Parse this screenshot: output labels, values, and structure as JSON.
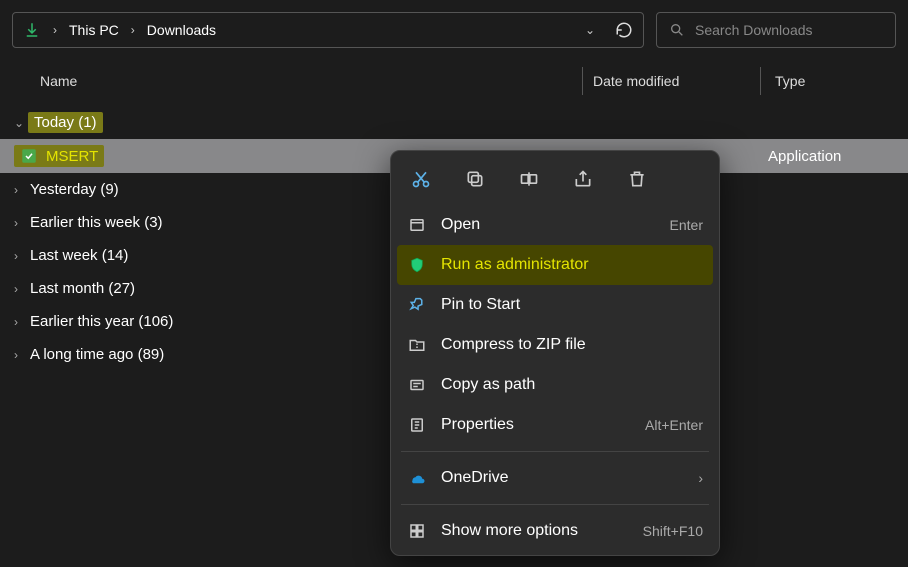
{
  "breadcrumb": {
    "root": "This PC",
    "current": "Downloads"
  },
  "search": {
    "placeholder": "Search Downloads"
  },
  "columns": {
    "name": "Name",
    "date": "Date modified",
    "type": "Type"
  },
  "groups": [
    {
      "label": "Today (1)",
      "expanded": true,
      "highlighted": true
    },
    {
      "label": "Yesterday (9)",
      "expanded": false
    },
    {
      "label": "Earlier this week (3)",
      "expanded": false
    },
    {
      "label": "Last week (14)",
      "expanded": false
    },
    {
      "label": "Last month (27)",
      "expanded": false
    },
    {
      "label": "Earlier this year (106)",
      "expanded": false
    },
    {
      "label": "A long time ago (89)",
      "expanded": false
    }
  ],
  "file": {
    "name": "MSERT",
    "type": "Application"
  },
  "context_menu": {
    "icon_row": [
      "cut",
      "copy",
      "rename",
      "share",
      "delete"
    ],
    "items": [
      {
        "icon": "open-icon",
        "label": "Open",
        "shortcut": "Enter"
      },
      {
        "icon": "shield-icon",
        "label": "Run as administrator",
        "highlighted": true
      },
      {
        "icon": "pin-icon",
        "label": "Pin to Start"
      },
      {
        "icon": "zip-icon",
        "label": "Compress to ZIP file"
      },
      {
        "icon": "path-icon",
        "label": "Copy as path"
      },
      {
        "icon": "properties-icon",
        "label": "Properties",
        "shortcut": "Alt+Enter"
      }
    ],
    "onedrive": {
      "label": "OneDrive"
    },
    "more": {
      "label": "Show more options",
      "shortcut": "Shift+F10"
    }
  }
}
